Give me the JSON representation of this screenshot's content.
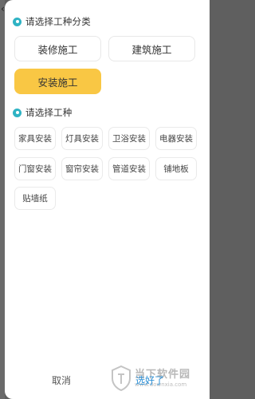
{
  "section1": {
    "title": "请选择工种分类",
    "options": [
      {
        "label": "装修施工",
        "selected": false
      },
      {
        "label": "建筑施工",
        "selected": false
      },
      {
        "label": "安装施工",
        "selected": true
      }
    ]
  },
  "section2": {
    "title": "请选择工种",
    "options": [
      {
        "label": "家具安装"
      },
      {
        "label": "灯具安装"
      },
      {
        "label": "卫浴安装"
      },
      {
        "label": "电器安装"
      },
      {
        "label": "门窗安装"
      },
      {
        "label": "窗帘安装"
      },
      {
        "label": "管道安装"
      },
      {
        "label": "铺地板"
      },
      {
        "label": "贴墙纸"
      }
    ]
  },
  "footer": {
    "cancel_label": "取消",
    "confirm_label": "选好了"
  },
  "watermark": {
    "brand": "当下软件园",
    "url": "www.downxia.com"
  },
  "colors": {
    "accent": "#2fb3c4",
    "selected": "#f9c744",
    "confirm": "#2a8fd6",
    "overlay": "#5f5f5f"
  },
  "icons": {
    "section_marker": "dot-icon",
    "back": "back-chevron-icon",
    "watermark_logo": "shield-logo-icon"
  }
}
